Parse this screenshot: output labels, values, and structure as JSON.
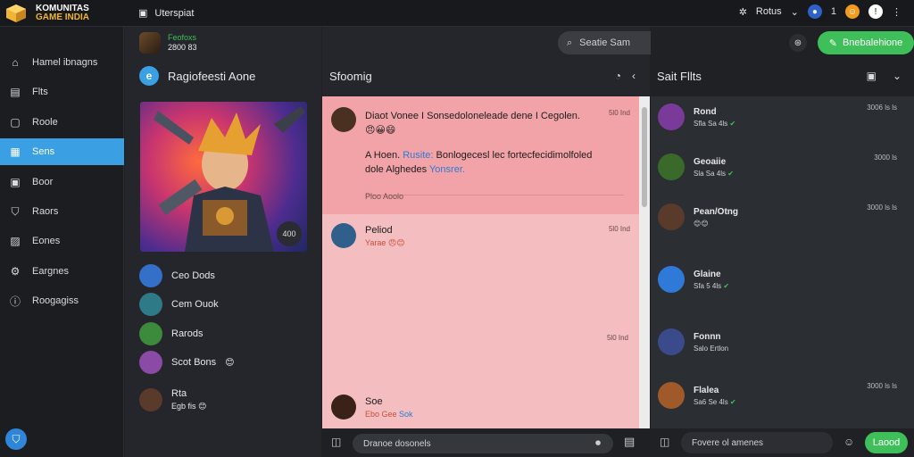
{
  "brand": {
    "line1": "KOMUNITAS",
    "line2": "GAME INDIA"
  },
  "titlebar": {
    "title": "Uterspiat",
    "status": "Rotus",
    "badge_count": "1"
  },
  "search": {
    "placeholder": "Seatie Sam"
  },
  "top_action": {
    "label": "Bnebalehione"
  },
  "sidebar": {
    "items": [
      {
        "label": "Hamel ibnagns",
        "icon": "home-icon"
      },
      {
        "label": "Flts",
        "icon": "list-icon"
      },
      {
        "label": "Roole",
        "icon": "book-icon"
      },
      {
        "label": "Sens",
        "icon": "grid-icon",
        "active": true
      },
      {
        "label": "Boor",
        "icon": "save-icon"
      },
      {
        "label": "Raors",
        "icon": "shield-icon"
      },
      {
        "label": "Eones",
        "icon": "image-icon"
      },
      {
        "label": "Eargnes",
        "icon": "gear-icon"
      },
      {
        "label": "Roogagiss",
        "icon": "info-icon"
      }
    ]
  },
  "profile": {
    "line1": "Feofoxs",
    "line2": "2800 83"
  },
  "channel": {
    "title": "Ragiofeesti Aone",
    "hero_badge": "400"
  },
  "members": [
    {
      "name": "Ceo Dods"
    },
    {
      "name": "Cem Ouok"
    },
    {
      "name": "Rarods"
    },
    {
      "name": "Scot Bons"
    },
    {
      "name": "Rta",
      "sub": "Egb fis"
    }
  ],
  "feed": {
    "title": "Sfoomig",
    "posts": [
      {
        "text": "Diaot Vonee I Sonsedoloneleade dene I Cegolen.",
        "text2_a": "A Hoen.",
        "text2_link": "Rusite:",
        "text2_b": "Bonlogecesl lec fortecfecidimolfoled",
        "text3_a": "dole Alghedes",
        "text3_link": "Yonsrer.",
        "meta": "Ploo Aoolo",
        "time": "5l0 Ind"
      },
      {
        "name": "Peliod",
        "sub": "Yarae",
        "time": "5l0 Ind"
      },
      {
        "time": "5l0 Ind"
      },
      {
        "name": "Soe",
        "sub": "Ebo Gee",
        "link": "Sok"
      }
    ],
    "compose_placeholder": "Dranoe dosonels"
  },
  "right": {
    "title": "Sait Fllts",
    "items": [
      {
        "name": "Rond",
        "sub": "Sfla Sa 4ls",
        "time": "3006 ls ls"
      },
      {
        "name": "Geoaiie",
        "sub": "Sla Sa 4ls",
        "time": "3000 ls"
      },
      {
        "name": "Pean/Otng",
        "sub": "",
        "time": "3000 ls ls"
      },
      {
        "name": "Glaine",
        "sub": "Sfa 5 4ls",
        "time": ""
      },
      {
        "name": "Fonnn",
        "sub": "Salo Ertlon",
        "time": ""
      },
      {
        "name": "Flalea",
        "sub": "Sa6 Se 4ls",
        "time": "3000 ls ls"
      }
    ],
    "compose_placeholder": "Fovere ol amenes",
    "send_label": "Laood"
  },
  "colors": {
    "accent": "#3a9fe3",
    "green": "#3fbf59",
    "feed_bg": "#f4bdbf"
  }
}
